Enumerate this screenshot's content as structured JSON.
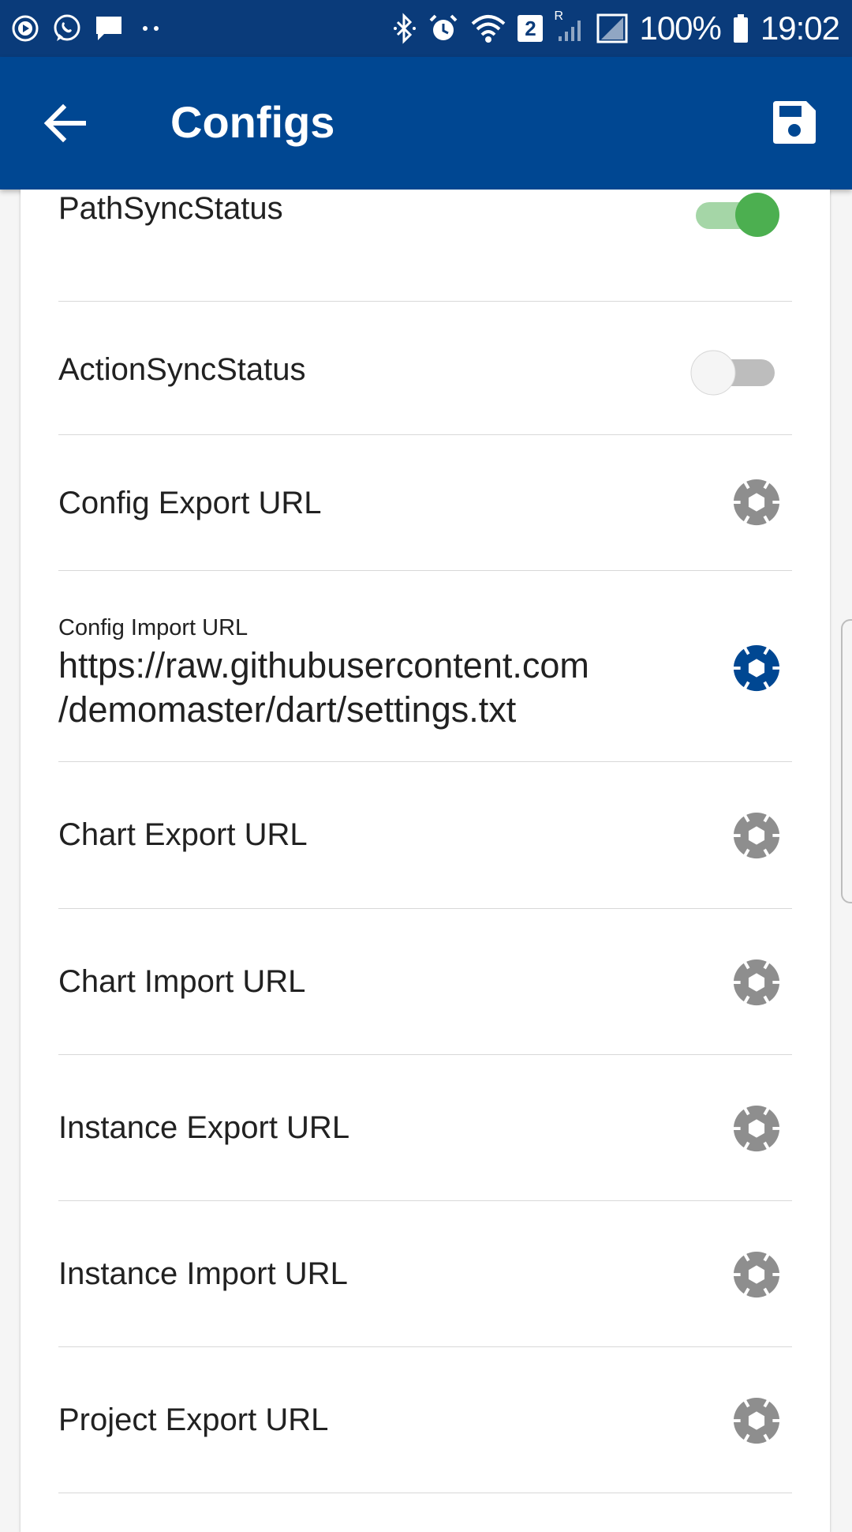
{
  "status_bar": {
    "battery": "100%",
    "time": "19:02",
    "sim_badge": "2",
    "roaming": "R",
    "left_icons": [
      "media-icon",
      "whatsapp-icon",
      "message-icon",
      "more-dots-icon"
    ],
    "right_icons": [
      "bluetooth-icon",
      "alarm-icon",
      "wifi-icon",
      "sim-badge-icon",
      "signal-icon",
      "signal-icon",
      "battery-icon"
    ]
  },
  "app_bar": {
    "title": "Configs",
    "back_icon": "arrow-back-icon",
    "save_icon": "save-icon",
    "color": "#004792"
  },
  "settings": {
    "path_sync": {
      "label": "PathSyncStatus",
      "enabled": true
    },
    "action_sync": {
      "label": "ActionSyncStatus",
      "enabled": false
    },
    "config_export": {
      "label": "Config Export URL"
    },
    "config_import": {
      "label": "Config Import URL",
      "value_line1": "https://raw.githubusercontent.com",
      "value_line2": "/demomaster/dart/settings.txt"
    },
    "chart_export": {
      "label": "Chart Export URL"
    },
    "chart_import": {
      "label": "Chart Import URL"
    },
    "instance_export": {
      "label": "Instance Export URL"
    },
    "instance_import": {
      "label": "Instance Import URL"
    },
    "project_export": {
      "label": "Project Export URL"
    }
  },
  "colors": {
    "accent_green": "#4caf50",
    "icon_active": "#004792",
    "icon_inactive": "#8e8e8e"
  }
}
